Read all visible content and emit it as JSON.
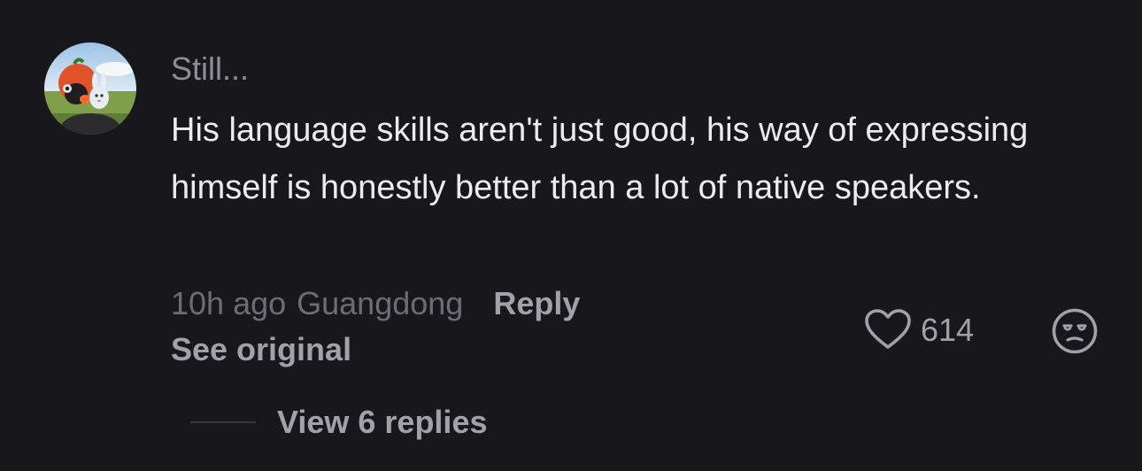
{
  "comment": {
    "avatar_icon": "user-avatar",
    "username": "Still...",
    "text": "His language skills aren't just good, his way of expressing himself is honestly better than a lot of native speakers.",
    "time": "10h ago",
    "location": "Guangdong",
    "reply_label": "Reply",
    "see_original_label": "See original",
    "like_icon": "heart-outline-icon",
    "like_count": "614",
    "dislike_icon": "unamused-face-icon",
    "view_replies_label": "View 6 replies"
  },
  "colors": {
    "background": "#18171c",
    "primary_text": "#ecebf0",
    "secondary_text": "#a2a1a7",
    "muted_text": "#6e6d73"
  }
}
